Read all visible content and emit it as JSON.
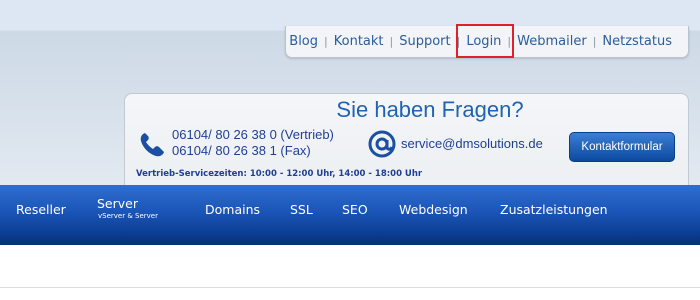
{
  "utility_nav": {
    "links": [
      {
        "label": "Blog"
      },
      {
        "label": "Kontakt"
      },
      {
        "label": "Support"
      },
      {
        "label": "Login"
      },
      {
        "label": "Webmailer"
      },
      {
        "label": "Netzstatus"
      }
    ],
    "separator": "|",
    "highlight_color": "#e0202a"
  },
  "contact": {
    "title": "Sie haben Fragen?",
    "phone_lines": [
      "06104/ 80 26 38 0 (Vertrieb)",
      "06104/ 80 26 38 1 (Fax)"
    ],
    "email": "service@dmsolutions.de",
    "button_label": "Kontaktformular",
    "hours": "Vertrieb-Servicezeiten: 10:00 - 12:00 Uhr, 14:00 - 18:00 Uhr",
    "accent_color": "#1f63b5"
  },
  "main_nav": {
    "items": [
      {
        "label": "Reseller"
      },
      {
        "label": "Server",
        "sublabel": "vServer & Server"
      },
      {
        "label": "Domains"
      },
      {
        "label": "SSL"
      },
      {
        "label": "SEO"
      },
      {
        "label": "Webdesign"
      },
      {
        "label": "Zusatzleistungen"
      }
    ],
    "background_color": "#1a55b7"
  },
  "icons": {
    "phone": "phone-icon",
    "email": "at-icon"
  }
}
